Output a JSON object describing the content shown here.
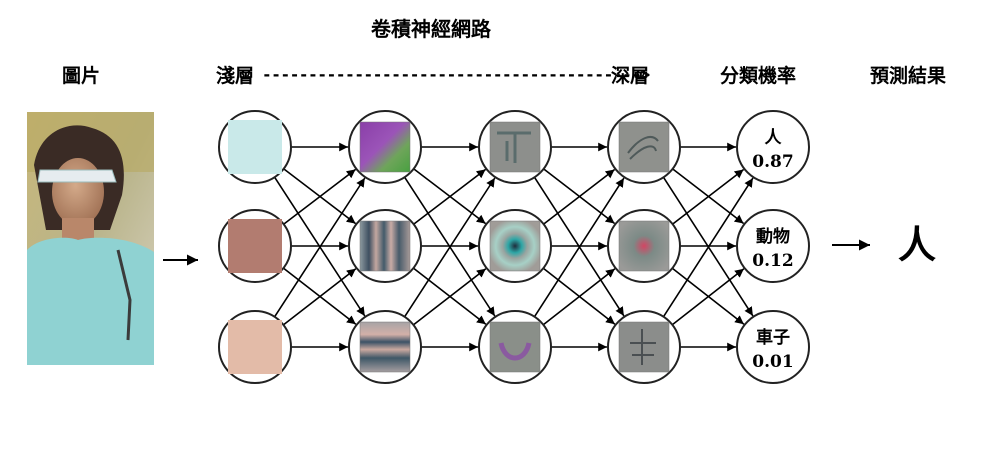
{
  "title": "卷積神經網路",
  "labels": {
    "image": "圖片",
    "shallow": "淺層",
    "arrow_text": "----------------------------------------->",
    "deep": "深層",
    "probability": "分類機率",
    "prediction": "預測結果"
  },
  "outputs": [
    {
      "label": "人",
      "value": "0.87"
    },
    {
      "label": "動物",
      "value": "0.12"
    },
    {
      "label": "車子",
      "value": "0.01"
    }
  ],
  "result": "人",
  "colors": {
    "layer1_swatches": [
      "#c9e9e9",
      "#b27c70",
      "#e3bba8"
    ],
    "node_stroke": "#222222",
    "arrow": "#000000"
  },
  "icons": {
    "input_photo": "photo-of-woman",
    "feature_maps": "filter-visualization-icon"
  }
}
